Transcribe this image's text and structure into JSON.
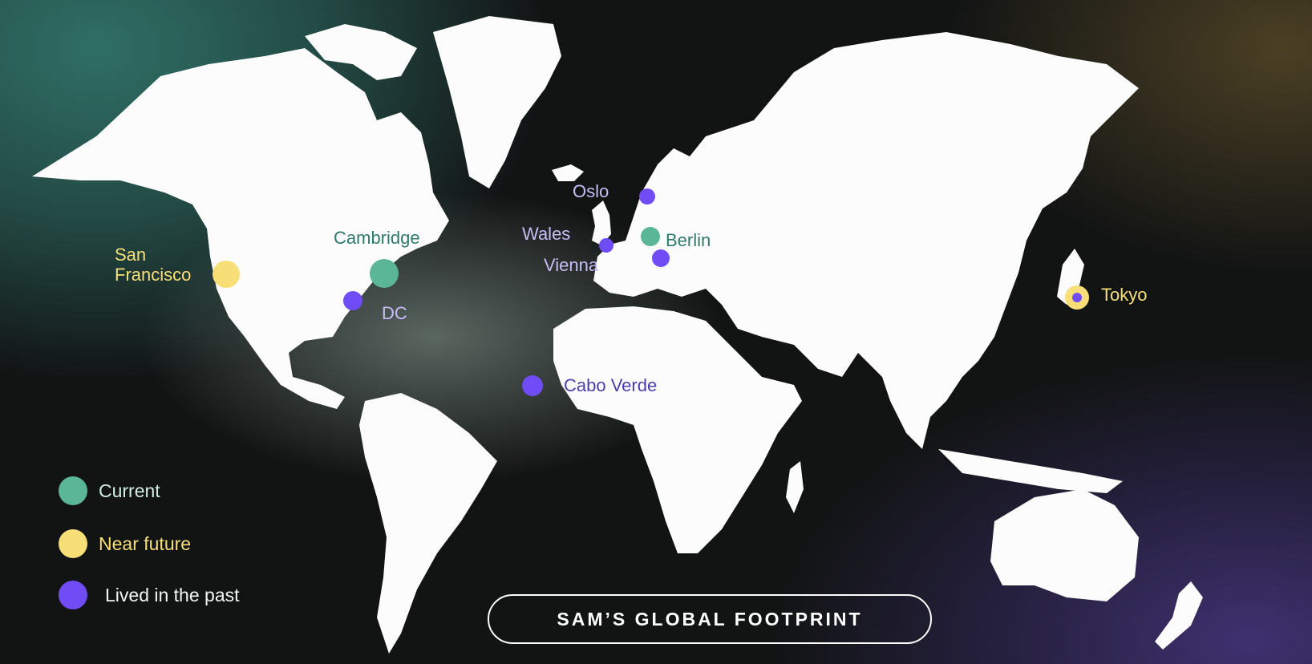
{
  "map": {
    "title": "SAM’S GLOBAL FOOTPRINT",
    "colors": {
      "current": "#5bb597",
      "near_future": "#f8de77",
      "past": "#6f4cf5",
      "land": "#fcfcfc"
    },
    "places": [
      {
        "name": "San Francisco",
        "label_lines": [
          "San",
          "Francisco"
        ],
        "category": "near_future"
      },
      {
        "name": "Cambridge",
        "category": "current"
      },
      {
        "name": "DC",
        "category": "past"
      },
      {
        "name": "Oslo",
        "category": "past"
      },
      {
        "name": "Wales",
        "category": "past"
      },
      {
        "name": "Berlin",
        "category": "current"
      },
      {
        "name": "Vienna",
        "category": "past"
      },
      {
        "name": "Tokyo",
        "category": "near_future",
        "also": "past"
      },
      {
        "name": "Cabo Verde",
        "category": "past"
      }
    ],
    "legend": [
      {
        "label": "Current",
        "category": "current"
      },
      {
        "label": "Near future",
        "category": "near_future"
      },
      {
        "label": "Lived in the past",
        "category": "past"
      }
    ]
  }
}
